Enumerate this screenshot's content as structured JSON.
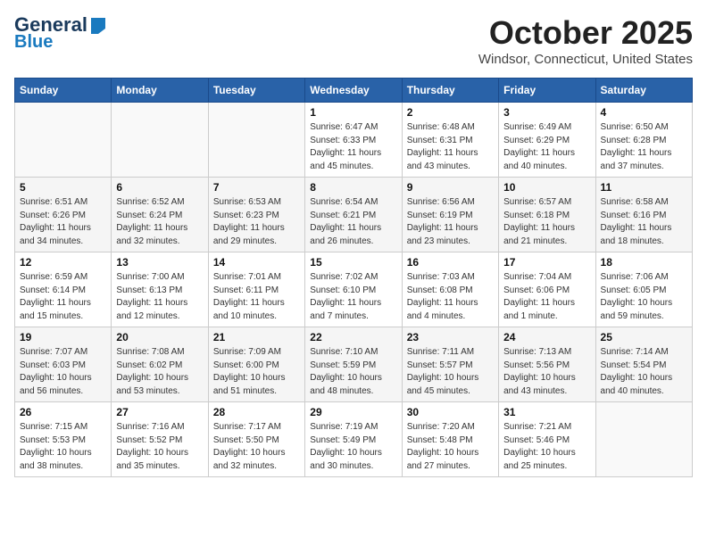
{
  "header": {
    "logo_line1": "General",
    "logo_line2": "Blue",
    "month": "October 2025",
    "location": "Windsor, Connecticut, United States"
  },
  "weekdays": [
    "Sunday",
    "Monday",
    "Tuesday",
    "Wednesday",
    "Thursday",
    "Friday",
    "Saturday"
  ],
  "weeks": [
    [
      {
        "day": "",
        "info": ""
      },
      {
        "day": "",
        "info": ""
      },
      {
        "day": "",
        "info": ""
      },
      {
        "day": "1",
        "info": "Sunrise: 6:47 AM\nSunset: 6:33 PM\nDaylight: 11 hours\nand 45 minutes."
      },
      {
        "day": "2",
        "info": "Sunrise: 6:48 AM\nSunset: 6:31 PM\nDaylight: 11 hours\nand 43 minutes."
      },
      {
        "day": "3",
        "info": "Sunrise: 6:49 AM\nSunset: 6:29 PM\nDaylight: 11 hours\nand 40 minutes."
      },
      {
        "day": "4",
        "info": "Sunrise: 6:50 AM\nSunset: 6:28 PM\nDaylight: 11 hours\nand 37 minutes."
      }
    ],
    [
      {
        "day": "5",
        "info": "Sunrise: 6:51 AM\nSunset: 6:26 PM\nDaylight: 11 hours\nand 34 minutes."
      },
      {
        "day": "6",
        "info": "Sunrise: 6:52 AM\nSunset: 6:24 PM\nDaylight: 11 hours\nand 32 minutes."
      },
      {
        "day": "7",
        "info": "Sunrise: 6:53 AM\nSunset: 6:23 PM\nDaylight: 11 hours\nand 29 minutes."
      },
      {
        "day": "8",
        "info": "Sunrise: 6:54 AM\nSunset: 6:21 PM\nDaylight: 11 hours\nand 26 minutes."
      },
      {
        "day": "9",
        "info": "Sunrise: 6:56 AM\nSunset: 6:19 PM\nDaylight: 11 hours\nand 23 minutes."
      },
      {
        "day": "10",
        "info": "Sunrise: 6:57 AM\nSunset: 6:18 PM\nDaylight: 11 hours\nand 21 minutes."
      },
      {
        "day": "11",
        "info": "Sunrise: 6:58 AM\nSunset: 6:16 PM\nDaylight: 11 hours\nand 18 minutes."
      }
    ],
    [
      {
        "day": "12",
        "info": "Sunrise: 6:59 AM\nSunset: 6:14 PM\nDaylight: 11 hours\nand 15 minutes."
      },
      {
        "day": "13",
        "info": "Sunrise: 7:00 AM\nSunset: 6:13 PM\nDaylight: 11 hours\nand 12 minutes."
      },
      {
        "day": "14",
        "info": "Sunrise: 7:01 AM\nSunset: 6:11 PM\nDaylight: 11 hours\nand 10 minutes."
      },
      {
        "day": "15",
        "info": "Sunrise: 7:02 AM\nSunset: 6:10 PM\nDaylight: 11 hours\nand 7 minutes."
      },
      {
        "day": "16",
        "info": "Sunrise: 7:03 AM\nSunset: 6:08 PM\nDaylight: 11 hours\nand 4 minutes."
      },
      {
        "day": "17",
        "info": "Sunrise: 7:04 AM\nSunset: 6:06 PM\nDaylight: 11 hours\nand 1 minute."
      },
      {
        "day": "18",
        "info": "Sunrise: 7:06 AM\nSunset: 6:05 PM\nDaylight: 10 hours\nand 59 minutes."
      }
    ],
    [
      {
        "day": "19",
        "info": "Sunrise: 7:07 AM\nSunset: 6:03 PM\nDaylight: 10 hours\nand 56 minutes."
      },
      {
        "day": "20",
        "info": "Sunrise: 7:08 AM\nSunset: 6:02 PM\nDaylight: 10 hours\nand 53 minutes."
      },
      {
        "day": "21",
        "info": "Sunrise: 7:09 AM\nSunset: 6:00 PM\nDaylight: 10 hours\nand 51 minutes."
      },
      {
        "day": "22",
        "info": "Sunrise: 7:10 AM\nSunset: 5:59 PM\nDaylight: 10 hours\nand 48 minutes."
      },
      {
        "day": "23",
        "info": "Sunrise: 7:11 AM\nSunset: 5:57 PM\nDaylight: 10 hours\nand 45 minutes."
      },
      {
        "day": "24",
        "info": "Sunrise: 7:13 AM\nSunset: 5:56 PM\nDaylight: 10 hours\nand 43 minutes."
      },
      {
        "day": "25",
        "info": "Sunrise: 7:14 AM\nSunset: 5:54 PM\nDaylight: 10 hours\nand 40 minutes."
      }
    ],
    [
      {
        "day": "26",
        "info": "Sunrise: 7:15 AM\nSunset: 5:53 PM\nDaylight: 10 hours\nand 38 minutes."
      },
      {
        "day": "27",
        "info": "Sunrise: 7:16 AM\nSunset: 5:52 PM\nDaylight: 10 hours\nand 35 minutes."
      },
      {
        "day": "28",
        "info": "Sunrise: 7:17 AM\nSunset: 5:50 PM\nDaylight: 10 hours\nand 32 minutes."
      },
      {
        "day": "29",
        "info": "Sunrise: 7:19 AM\nSunset: 5:49 PM\nDaylight: 10 hours\nand 30 minutes."
      },
      {
        "day": "30",
        "info": "Sunrise: 7:20 AM\nSunset: 5:48 PM\nDaylight: 10 hours\nand 27 minutes."
      },
      {
        "day": "31",
        "info": "Sunrise: 7:21 AM\nSunset: 5:46 PM\nDaylight: 10 hours\nand 25 minutes."
      },
      {
        "day": "",
        "info": ""
      }
    ]
  ]
}
